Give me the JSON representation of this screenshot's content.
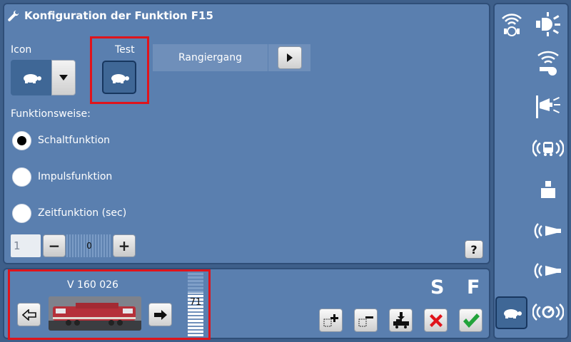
{
  "header": {
    "title": "Konfiguration der Funktion F15",
    "icon": "wrench-icon"
  },
  "config": {
    "icon_label": "Icon",
    "test_label": "Test",
    "function_name": "Rangiergang",
    "mode_label": "Funktionsweise:",
    "modes": [
      {
        "label": "Schaltfunktion",
        "selected": true
      },
      {
        "label": "Impulsfunktion",
        "selected": false
      },
      {
        "label": "Zeitfunktion (sec)",
        "selected": false
      }
    ],
    "time_input_placeholder": "1",
    "time_value": "0",
    "minus_label": "−",
    "plus_label": "+",
    "help_label": "?"
  },
  "loco": {
    "name": "V 160 026",
    "speed": "71",
    "s_label": "S",
    "f_label": "F"
  },
  "side_icons": [
    "radio-sound-icon",
    "light-icon",
    "whistle-icon",
    "horn-icon",
    "coupler-sound-icon",
    "weight-icon",
    "horn-left-icon",
    "horn-left-2-icon",
    "turtle-icon",
    "brake-sound-icon"
  ],
  "colors": {
    "accent_red": "#e0141b",
    "panel": "#5a7faf",
    "green_check": "#22a33b",
    "red_x": "#e0141b"
  }
}
